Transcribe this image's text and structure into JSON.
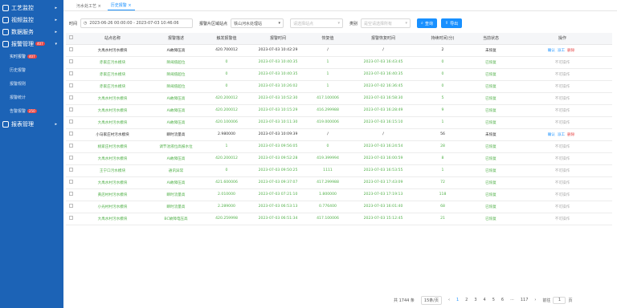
{
  "sidebar": {
    "items": [
      {
        "label": "工艺监控",
        "arrow": "▸"
      },
      {
        "label": "视频监控",
        "arrow": "▸"
      },
      {
        "label": "数据服务",
        "arrow": "▸"
      },
      {
        "label": "报警管理",
        "arrow": "▾",
        "badge": "407"
      }
    ],
    "subs": [
      {
        "label": "实时报警",
        "badge": "407"
      },
      {
        "label": "历史报警"
      },
      {
        "label": "报警规则"
      },
      {
        "label": "报警统计"
      },
      {
        "label": "告警报警",
        "badge": "250"
      }
    ],
    "last": {
      "label": "报表管理",
      "arrow": "▸"
    }
  },
  "tabs": [
    {
      "label": "污水处工艺 ×"
    },
    {
      "label": "历史报警 ×"
    }
  ],
  "filter": {
    "time_label": "时间",
    "time_value": "2023-06-26 00:00:00  -  2023-07-03 10:46:06",
    "area_label": "报警片区域站点",
    "area_value": "铁山河水处理站",
    "site_placeholder": "请选择站点",
    "type_label": "类别",
    "type_placeholder": "是空请选择所有",
    "search": "查询",
    "export": "导出"
  },
  "table": {
    "headers": [
      "",
      "站点名称",
      "报警描述",
      "触发报警值",
      "报警时间",
      "恢复值",
      "报警恢复时间",
      "持续时间(分)",
      "当前状态",
      "操作"
    ],
    "rows": [
      {
        "c": "black",
        "v": [
          "大禹水村污水模块",
          "AI故障压高",
          "420.700012",
          "2023-07-03 10:42:29",
          "/",
          "/",
          "2",
          "未恢复"
        ],
        "op": "full"
      },
      {
        "c": "green",
        "v": [
          "赤家庄污水模块",
          "降阈值超位",
          "0",
          "2023-07-03 10:40:35",
          "1",
          "2023-07-03 16:43:45",
          "0",
          "已恢复"
        ],
        "op": "none"
      },
      {
        "c": "green",
        "v": [
          "赤家庄污水模块",
          "降阈值超位",
          "0",
          "2023-07-03 10:40:35",
          "1",
          "2023-07-03 16:40:35",
          "0",
          "已恢复"
        ],
        "op": "none"
      },
      {
        "c": "green",
        "v": [
          "赤家庄污水模块",
          "降阈值超位",
          "0",
          "2023-07-03 10:26:02",
          "1",
          "2023-07-02 16:36:45",
          "0",
          "已恢复"
        ],
        "op": "none"
      },
      {
        "c": "green",
        "v": [
          "大禹水村污水模块",
          "AI故障压高",
          "420.200012",
          "2023-07-03 10:52:30",
          "417.100006",
          "2023-07-03 16:58:30",
          "5",
          "已恢复"
        ],
        "op": "none"
      },
      {
        "c": "green",
        "v": [
          "大禹水村污水模块",
          "AI故障压高",
          "420.200012",
          "2023-07-03 10:15:29",
          "416.299988",
          "2023-07-03 16:28:49",
          "9",
          "已恢复"
        ],
        "op": "none"
      },
      {
        "c": "green",
        "v": [
          "大禹水村污水模块",
          "AI故障压高",
          "420.100006",
          "2023-07-03 10:11:30",
          "419.000006",
          "2023-07-03 16:15:10",
          "1",
          "已恢复"
        ],
        "op": "none"
      },
      {
        "c": "black",
        "v": [
          "小马家庄村污水模块",
          "瞬时流量高",
          "2.980000",
          "2023-07-03 10:09:39",
          "/",
          "/",
          "56",
          "未恢复"
        ],
        "op": "full"
      },
      {
        "c": "green",
        "v": [
          "桃家庄村污水模块",
          "调节池液位高报水位",
          "1",
          "2023-07-03 09:56:05",
          "0",
          "2023-07-03 16:24:54",
          "28",
          "已恢复"
        ],
        "op": "none"
      },
      {
        "c": "green",
        "v": [
          "大禹水村污水模块",
          "AI故障压高",
          "420.200012",
          "2023-07-03 09:52:28",
          "419.399994",
          "2023-07-03 16:00:59",
          "8",
          "已恢复"
        ],
        "op": "none"
      },
      {
        "c": "green",
        "v": [
          "王宁口污水模块",
          "通讯异常",
          "0",
          "2023-07-03 09:50:25",
          "1111",
          "2023-07-03 16:53:55",
          "1",
          "已恢复"
        ],
        "op": "none"
      },
      {
        "c": "green",
        "v": [
          "大禹水村污水模块",
          "AI故障压高",
          "421.600006",
          "2023-07-03 09:37:07",
          "417.299988",
          "2023-07-03 17:43:09",
          "72",
          "已恢复"
        ],
        "op": "none"
      },
      {
        "c": "green",
        "v": [
          "黄店村村污水模块",
          "瞬时流量高",
          "2.010000",
          "2023-07-03 07:21:10",
          "1.800000",
          "2023-07-03 17:19:13",
          "118",
          "已恢复"
        ],
        "op": "none"
      },
      {
        "c": "green",
        "v": [
          "小光村村污水模块",
          "瞬时流量高",
          "2.289000",
          "2023-07-03 06:53:13",
          "0.776400",
          "2023-07-03 16:01:40",
          "68",
          "已恢复"
        ],
        "op": "none"
      },
      {
        "c": "green",
        "v": [
          "大禹水村污水模块",
          "BC故障电压高",
          "420.259998",
          "2023-07-03 06:51:34",
          "417.100006",
          "2023-07-03 15:12:45",
          "21",
          "已恢复"
        ],
        "op": "none"
      }
    ],
    "op_confirm": "确认",
    "op_work": "派工",
    "op_delete": "删除",
    "op_none": "不可操作"
  },
  "pager": {
    "total": "共 1744 条",
    "size": "15条/页",
    "prev": "‹",
    "pages": [
      "1",
      "2",
      "3",
      "4",
      "5",
      "6",
      "···",
      "117"
    ],
    "next": "›",
    "goto": "前往",
    "goto_value": "1",
    "page_unit": "页"
  },
  "colors": {
    "sidebar": "#1c63b6",
    "accent": "#1890ff",
    "recovered": "#52b14a",
    "danger": "#e64646"
  }
}
